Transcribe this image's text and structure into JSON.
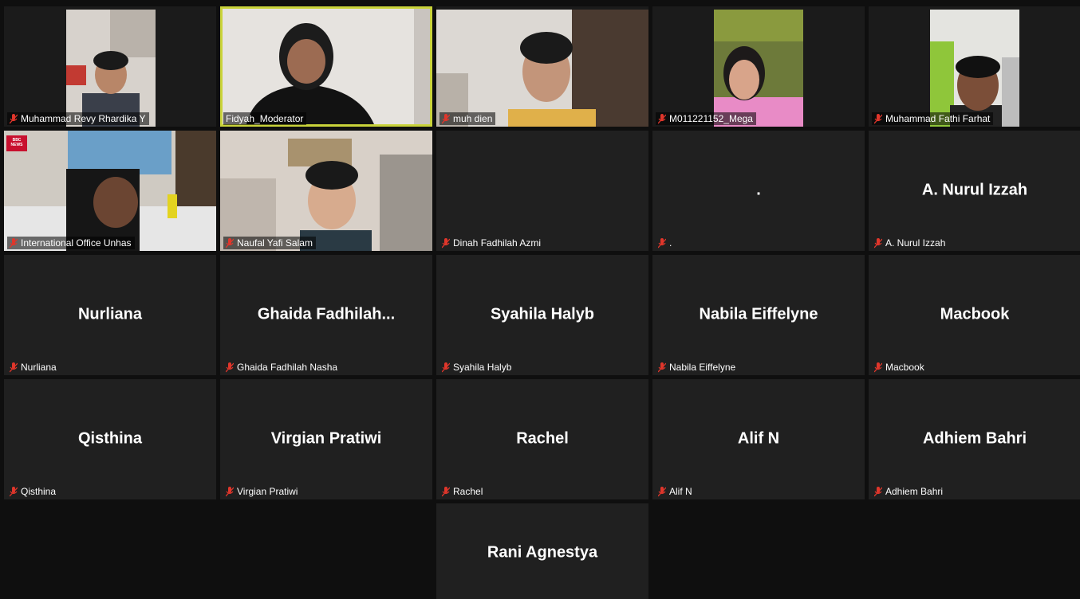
{
  "participants": [
    {
      "name": "Muhammad Revy Rhardika Y",
      "display": "",
      "muted": true
    },
    {
      "name": "Fidyah_Moderator",
      "display": "",
      "muted": false,
      "active": true
    },
    {
      "name": "muh dien",
      "display": "",
      "muted": true
    },
    {
      "name": "M011221152_Mega",
      "display": "",
      "muted": true
    },
    {
      "name": "Muhammad Fathi Farhat",
      "display": "",
      "muted": true
    },
    {
      "name": "International Office Unhas",
      "display": "",
      "muted": true
    },
    {
      "name": "Naufal Yafi Salam",
      "display": "",
      "muted": true
    },
    {
      "name": "Dinah Fadhilah Azmi",
      "display": "",
      "muted": true
    },
    {
      "name": ".",
      "display": ".",
      "muted": true
    },
    {
      "name": "A. Nurul Izzah",
      "display": "A. Nurul Izzah",
      "muted": true
    },
    {
      "name": "Nurliana",
      "display": "Nurliana",
      "muted": true
    },
    {
      "name": "Ghaida Fadhilah Nasha",
      "display": "Ghaida  Fadhilah...",
      "muted": true
    },
    {
      "name": "Syahila Halyb",
      "display": "Syahila Halyb",
      "muted": true
    },
    {
      "name": "Nabila Eiffelyne",
      "display": "Nabila Eiffelyne",
      "muted": true
    },
    {
      "name": "Macbook",
      "display": "Macbook",
      "muted": true
    },
    {
      "name": "Qisthina",
      "display": "Qisthina",
      "muted": true
    },
    {
      "name": "Virgian Pratiwi",
      "display": "Virgian Pratiwi",
      "muted": true
    },
    {
      "name": "Rachel",
      "display": "Rachel",
      "muted": true
    },
    {
      "name": "Alif N",
      "display": "Alif N",
      "muted": true
    },
    {
      "name": "Adhiem Bahri",
      "display": "Adhiem Bahri",
      "muted": true
    },
    {
      "name": "",
      "display": "Rani Agnestya",
      "muted": true
    }
  ],
  "overlay": {
    "news_badge": "BBC NEWS"
  },
  "colors": {
    "active_speaker": "#c9d33a",
    "muted_icon": "#e0362b",
    "tile_bg": "#202020"
  }
}
